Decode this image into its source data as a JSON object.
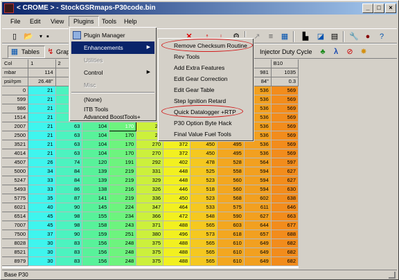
{
  "window": {
    "title": "< CROME > - StockGSRmaps-P30code.bin",
    "controls": [
      "_",
      "□",
      "×"
    ]
  },
  "menubar": [
    "File",
    "Edit",
    "View",
    "Plugins",
    "Tools",
    "Help"
  ],
  "toolbar2": {
    "tables": "Tables",
    "graph": "Graph",
    "injector_duty": "Injector Duty Cycle"
  },
  "plugins_menu": [
    "Plugin Manager",
    "Enhancements",
    "Utilities",
    "Control",
    "Misc",
    "(None)",
    "ITB Tools",
    "Advanced BoostTools+"
  ],
  "enhancements_menu": [
    "Remove Checksum Routine",
    "Rev Tools",
    "Add Extra Features",
    "Edit Gear Correction",
    "Edit Gear Table",
    "Step Ignition Retard",
    "Quick Datalogger +RTP",
    "P30 Option Byte Hack",
    "Final Value Fuel Tools"
  ],
  "grid": {
    "header_rows": [
      [
        "Col",
        "1",
        "2",
        "",
        "",
        "",
        "",
        "",
        "",
        "",
        "B10"
      ],
      [
        "mbar",
        "114",
        "",
        "",
        "",
        "",
        "",
        "",
        "",
        "981",
        "1035"
      ],
      [
        "psi/rpm",
        "26.48\"",
        "23.",
        "",
        "",
        "",
        "",
        "",
        "",
        "84\"",
        "0.3"
      ]
    ],
    "rows": [
      [
        "0",
        "21",
        "",
        "",
        "",
        "",
        "",
        "",
        "",
        "536",
        "569"
      ],
      [
        "599",
        "21",
        "",
        "",
        "",
        "",
        "",
        "",
        "",
        "536",
        "569"
      ],
      [
        "986",
        "21",
        "",
        "",
        "",
        "",
        "",
        "",
        "",
        "536",
        "569"
      ],
      [
        "1514",
        "21",
        "",
        "",
        "",
        "",
        "",
        "",
        "",
        "536",
        "569"
      ],
      [
        "2007",
        "21",
        "63",
        "104",
        "170",
        "27",
        "",
        "",
        "",
        "536",
        "569"
      ],
      [
        "2500",
        "21",
        "63",
        "104",
        "170",
        "27",
        "",
        "",
        "",
        "536",
        "569"
      ],
      [
        "3521",
        "21",
        "63",
        "104",
        "170",
        "270",
        "372",
        "450",
        "495",
        "536",
        "569"
      ],
      [
        "4014",
        "21",
        "63",
        "104",
        "170",
        "270",
        "372",
        "450",
        "495",
        "536",
        "569"
      ],
      [
        "4507",
        "26",
        "74",
        "120",
        "191",
        "292",
        "402",
        "478",
        "528",
        "564",
        "597"
      ],
      [
        "5000",
        "34",
        "84",
        "139",
        "219",
        "331",
        "448",
        "525",
        "558",
        "594",
        "627"
      ],
      [
        "5247",
        "33",
        "84",
        "139",
        "219",
        "329",
        "448",
        "523",
        "560",
        "594",
        "627"
      ],
      [
        "5493",
        "33",
        "86",
        "138",
        "216",
        "326",
        "446",
        "518",
        "560",
        "594",
        "630"
      ],
      [
        "5775",
        "35",
        "87",
        "141",
        "219",
        "336",
        "450",
        "523",
        "568",
        "602",
        "638"
      ],
      [
        "6021",
        "40",
        "90",
        "145",
        "224",
        "347",
        "464",
        "533",
        "575",
        "611",
        "646"
      ],
      [
        "6514",
        "45",
        "98",
        "155",
        "234",
        "366",
        "472",
        "548",
        "590",
        "627",
        "663"
      ],
      [
        "7007",
        "45",
        "98",
        "158",
        "243",
        "371",
        "488",
        "565",
        "603",
        "644",
        "677"
      ],
      [
        "7500",
        "37",
        "90",
        "159",
        "251",
        "380",
        "496",
        "573",
        "618",
        "657",
        "688"
      ],
      [
        "8028",
        "30",
        "83",
        "156",
        "248",
        "375",
        "488",
        "565",
        "610",
        "649",
        "682"
      ],
      [
        "8521",
        "30",
        "83",
        "156",
        "248",
        "375",
        "488",
        "565",
        "610",
        "649",
        "682"
      ],
      [
        "8979",
        "30",
        "83",
        "156",
        "248",
        "375",
        "488",
        "565",
        "610",
        "649",
        "682"
      ]
    ],
    "col_colors": [
      "#d4d0c8",
      "#3ff5ee",
      "#4cf3bf",
      "#58f29a",
      "#6df47e",
      "#ccf03c",
      "#f2f020",
      "#f5c820",
      "#f3a720",
      "#f2a020",
      "#f28c1c"
    ],
    "selected_cell": {
      "row": 4,
      "col": 4
    }
  },
  "status": "Base P30",
  "toolbar_icons": [
    "new-icon",
    "open-icon",
    "save-icon",
    "saveas-icon",
    "close-icon",
    "up-arrow-icon",
    "down-arrow-icon",
    "settings-icon",
    "graph-icon",
    "table-icon",
    "calc-icon",
    "chart-icon",
    "doc-icon",
    "tool-icon",
    "help-icon"
  ]
}
